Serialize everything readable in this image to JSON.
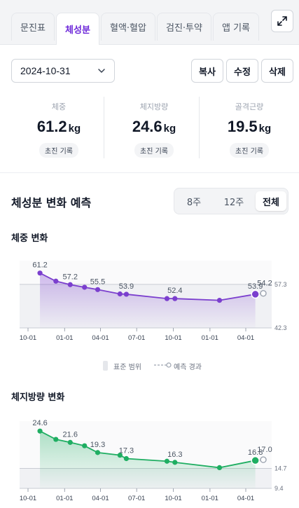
{
  "tabs": [
    {
      "label": "문진표",
      "active": false
    },
    {
      "label": "체성분",
      "active": true
    },
    {
      "label": "혈액·혈압",
      "active": false
    },
    {
      "label": "검진·투약",
      "active": false
    },
    {
      "label": "앱 기록",
      "active": false
    }
  ],
  "toolbar": {
    "date": "2024-10-31",
    "copy_label": "복사",
    "edit_label": "수정",
    "delete_label": "삭제"
  },
  "metrics": [
    {
      "label": "체중",
      "value": "61.2",
      "unit": "kg",
      "badge": "초진 기록"
    },
    {
      "label": "체지방량",
      "value": "24.6",
      "unit": "kg",
      "badge": "초진 기록"
    },
    {
      "label": "골격근량",
      "value": "19.5",
      "unit": "kg",
      "badge": "초진 기록"
    }
  ],
  "prediction": {
    "title": "체성분 변화 예측",
    "periods": [
      {
        "label": "8주",
        "active": false
      },
      {
        "label": "12주",
        "active": false
      },
      {
        "label": "전체",
        "active": true
      }
    ]
  },
  "legend": {
    "range_label": "표준 범위",
    "forecast_label": "예측 경과"
  },
  "colors": {
    "accent": "#6d28d9",
    "weight_line": "#7b3fce",
    "fat_line": "#1fae62"
  },
  "chart_data": [
    {
      "type": "line",
      "title": "체중 변화",
      "x_ticks": [
        "10-01",
        "01-01",
        "04-01",
        "07-01",
        "10-01",
        "01-01",
        "04-01"
      ],
      "x_tick_dates": [
        "2024-10-01",
        "2025-01-01",
        "2025-04-01",
        "2025-07-01",
        "2025-10-01",
        "2026-01-01",
        "2026-04-01"
      ],
      "ylim": [
        42.3,
        64.5
      ],
      "standard_range": [
        42.3,
        57.3
      ],
      "reference_labels": [
        "57.3",
        "42.3"
      ],
      "grid": false,
      "series": [
        {
          "x": [
            "2024-10-31",
            "2024-12-10",
            "2025-01-15",
            "2025-02-20",
            "2025-03-25",
            "2025-05-20",
            "2025-06-05",
            "2025-09-15",
            "2025-10-05",
            "2026-01-25",
            "2026-04-25"
          ],
          "values": [
            61.2,
            58.4,
            57.2,
            56.3,
            55.5,
            54.0,
            53.9,
            52.4,
            52.4,
            51.8,
            53.9
          ],
          "point_labels": [
            "61.2",
            "",
            "57.2",
            "",
            "55.5",
            "",
            "53.9",
            "",
            "52.4",
            "",
            "53.9"
          ]
        }
      ],
      "forecast": {
        "x": [
          "2026-04-25",
          "2026-05-15"
        ],
        "values": [
          53.9,
          54.2
        ],
        "label": "54.2"
      }
    },
    {
      "type": "line",
      "title": "체지방량 변화",
      "x_ticks": [
        "10-01",
        "01-01",
        "04-01",
        "07-01",
        "10-01",
        "01-01",
        "04-01"
      ],
      "x_tick_dates": [
        "2024-10-01",
        "2025-01-01",
        "2025-04-01",
        "2025-07-01",
        "2025-10-01",
        "2026-01-01",
        "2026-04-01"
      ],
      "ylim": [
        9.4,
        26.5
      ],
      "standard_range": [
        9.4,
        14.7
      ],
      "reference_labels": [
        "14.7",
        "9.4"
      ],
      "grid": false,
      "series": [
        {
          "x": [
            "2024-10-31",
            "2024-12-10",
            "2025-01-15",
            "2025-02-20",
            "2025-03-25",
            "2025-05-20",
            "2025-06-05",
            "2025-09-15",
            "2025-10-05",
            "2026-01-25",
            "2026-04-25"
          ],
          "values": [
            24.6,
            22.4,
            21.6,
            20.7,
            18.9,
            18.2,
            17.3,
            16.6,
            16.3,
            14.9,
            16.8
          ],
          "point_labels": [
            "24.6",
            "",
            "21.6",
            "",
            "19.3",
            "",
            "17.3",
            "",
            "16.3",
            "",
            "16.8"
          ]
        }
      ],
      "forecast": {
        "x": [
          "2026-04-25",
          "2026-05-15"
        ],
        "values": [
          16.8,
          17.0
        ],
        "label": "17.0"
      }
    }
  ]
}
